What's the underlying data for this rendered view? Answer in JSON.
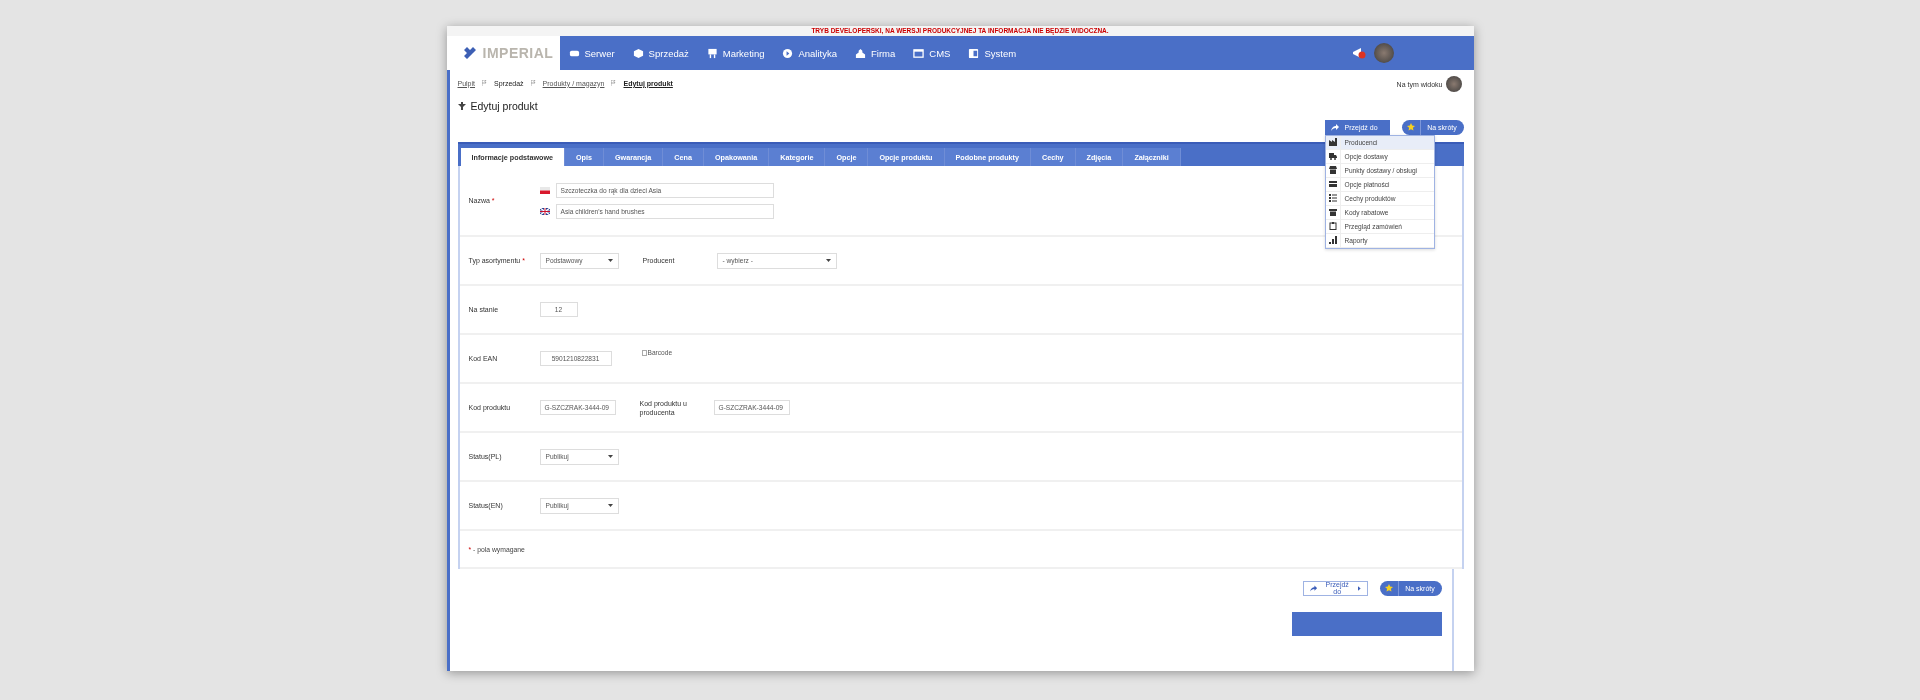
{
  "dev_notice": "TRYB DEVELOPERSKI, NA WERSJI PRODUKCYJNEJ TA INFORMACJA NIE BĘDZIE WIDOCZNA.",
  "logo": "IMPERIAL",
  "nav": [
    {
      "label": "Serwer",
      "kind": "server"
    },
    {
      "label": "Sprzedaż",
      "kind": "box"
    },
    {
      "label": "Marketing",
      "kind": "marketing"
    },
    {
      "label": "Analityka",
      "kind": "play"
    },
    {
      "label": "Firma",
      "kind": "building"
    },
    {
      "label": "CMS",
      "kind": "window"
    },
    {
      "label": "System",
      "kind": "system"
    }
  ],
  "breadcrumbs": [
    {
      "label": "Pulpit",
      "link": true
    },
    {
      "label": "Sprzedaż",
      "link": false
    },
    {
      "label": "Produkty / magazyn",
      "link": true
    },
    {
      "label": "Edytuj produkt",
      "link": false
    }
  ],
  "view_label": "Na tym widoku",
  "title": "Edytuj produkt",
  "goto_button": "Przejdź do",
  "shortcuts_button": "Na skróty",
  "goto_menu": [
    {
      "label": "Producenci",
      "kind": "factory",
      "selected": true
    },
    {
      "label": "Opcje dostawy",
      "kind": "truck",
      "selected": false
    },
    {
      "label": "Punkty dostawy / obsługi",
      "kind": "store",
      "selected": false
    },
    {
      "label": "Opcje płatności",
      "kind": "card",
      "selected": false
    },
    {
      "label": "Cechy produktów",
      "kind": "list",
      "selected": false
    },
    {
      "label": "Kody rabatowe",
      "kind": "gift",
      "selected": false
    },
    {
      "label": "Przegląd zamówień",
      "kind": "clipboard",
      "selected": false
    },
    {
      "label": "Raporty",
      "kind": "chart",
      "selected": false
    }
  ],
  "tabs": [
    {
      "label": "Informacje podstawowe",
      "selected": true
    },
    {
      "label": "Opis",
      "selected": false
    },
    {
      "label": "Gwarancja",
      "selected": false
    },
    {
      "label": "Cena",
      "selected": false
    },
    {
      "label": "Opakowania",
      "selected": false
    },
    {
      "label": "Kategorie",
      "selected": false
    },
    {
      "label": "Opcje",
      "selected": false
    },
    {
      "label": "Opcje produktu",
      "selected": false
    },
    {
      "label": "Podobne produkty",
      "selected": false
    },
    {
      "label": "Cechy",
      "selected": false
    },
    {
      "label": "Zdjęcia",
      "selected": false
    },
    {
      "label": "Załączniki",
      "selected": false
    }
  ],
  "form_rows": [
    {
      "kind": "translations",
      "label": "Nazwa",
      "required_mark": "*",
      "inputs": [
        {
          "kind": "pl",
          "value": "Szczoteczka do rąk dla dzieci Asia"
        },
        {
          "kind": "gb",
          "value": "Asia children's hand brushes"
        }
      ]
    },
    {
      "kind": "fields",
      "fields": [
        {
          "label": "Typ asortymentu",
          "required_mark": "*",
          "kind": "select",
          "value": "Podstawowy"
        },
        {
          "label": "Producent",
          "kind": "wide_select",
          "value": "- wybierz -"
        }
      ]
    },
    {
      "kind": "fields",
      "fields": [
        {
          "label": "Na stanie",
          "kind": "number_input",
          "value": "12"
        }
      ]
    },
    {
      "kind": "fields",
      "fields": [
        {
          "label": "Kod EAN",
          "kind": "ean_input",
          "value": "5901210822831"
        },
        {
          "kind": "broken_image",
          "value": "Barcode"
        }
      ]
    },
    {
      "kind": "fields",
      "fields": [
        {
          "label": "Kod produktu",
          "kind": "code_input",
          "value": "G-SZCZRAK-3444-09"
        },
        {
          "label": "Kod produktu u producenta",
          "kind": "code_input",
          "value": "G-SZCZRAK-3444-09"
        }
      ]
    },
    {
      "kind": "fields",
      "fields": [
        {
          "label": "Status(PL)",
          "kind": "select",
          "value": "Publikuj"
        }
      ]
    },
    {
      "kind": "fields",
      "fields": [
        {
          "label": "Status(EN)",
          "kind": "select",
          "value": "Publikuj"
        }
      ]
    }
  ],
  "required_note": {
    "mark": "*",
    "text": "- pola wymagane"
  },
  "footer_goto_button": "Przejdź do",
  "footer_shortcuts_button": "Na skróty"
}
